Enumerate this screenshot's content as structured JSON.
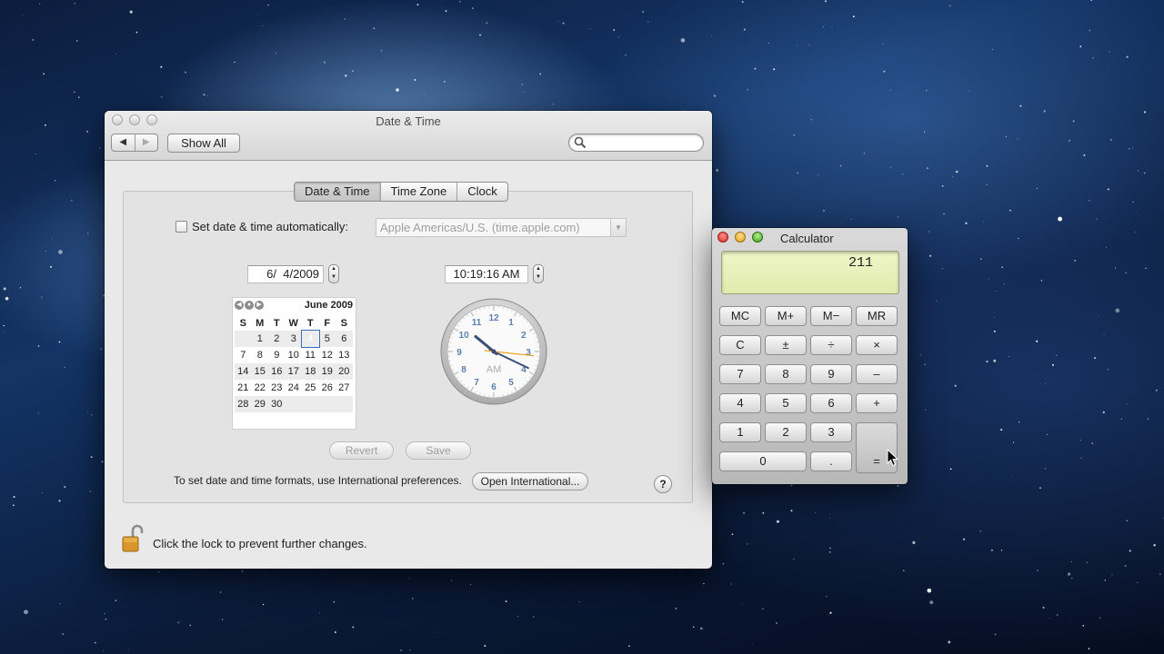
{
  "date_time_window": {
    "title": "Date & Time",
    "show_all_label": "Show All",
    "search": {
      "value": "",
      "placeholder": ""
    },
    "tabs": [
      {
        "label": "Date & Time",
        "selected": true
      },
      {
        "label": "Time Zone",
        "selected": false
      },
      {
        "label": "Clock",
        "selected": false
      }
    ],
    "auto_checkbox_label": "Set date & time automatically:",
    "auto_checked": false,
    "time_server": "Apple Americas/U.S. (time.apple.com)",
    "date_field": "6/  4/2009",
    "time_field": "10:19:16 AM",
    "calendar": {
      "month_label": "June 2009",
      "weekdays": [
        "S",
        "M",
        "T",
        "W",
        "T",
        "F",
        "S"
      ],
      "weeks": [
        [
          "",
          "1",
          "2",
          "3",
          "4",
          "5",
          "6"
        ],
        [
          "7",
          "8",
          "9",
          "10",
          "11",
          "12",
          "13"
        ],
        [
          "14",
          "15",
          "16",
          "17",
          "18",
          "19",
          "20"
        ],
        [
          "21",
          "22",
          "23",
          "24",
          "25",
          "26",
          "27"
        ],
        [
          "28",
          "29",
          "30",
          "",
          "",
          "",
          ""
        ]
      ],
      "selected_day": "4"
    },
    "clock": {
      "hour": 10,
      "minute": 19,
      "second": 16,
      "period_label": "AM",
      "numbers": [
        "12",
        "1",
        "2",
        "3",
        "4",
        "5",
        "6",
        "7",
        "8",
        "9",
        "10",
        "11"
      ]
    },
    "revert_label": "Revert",
    "save_label": "Save",
    "international_text": "To set date and time formats, use International preferences.",
    "open_international_label": "Open International...",
    "help_label": "?",
    "lock_text": "Click the lock to prevent further changes."
  },
  "calculator": {
    "title": "Calculator",
    "display": "211",
    "rows": [
      [
        "MC",
        "M+",
        "M−",
        "MR"
      ],
      [
        "C",
        "±",
        "÷",
        "×"
      ],
      [
        "7",
        "8",
        "9",
        "–"
      ],
      [
        "4",
        "5",
        "6",
        "+"
      ],
      [
        "1",
        "2",
        "3"
      ]
    ],
    "zero_label": "0",
    "dot_label": ".",
    "equals_label": "="
  },
  "colors": {
    "calendar_today": "#5b8ed6",
    "calculator_display": "#e8f2bd",
    "clock_numbers": "#5a7fb0",
    "close_red": "#d62d22",
    "minimize_yellow": "#e09f12",
    "zoom_green": "#3e9f1c"
  }
}
